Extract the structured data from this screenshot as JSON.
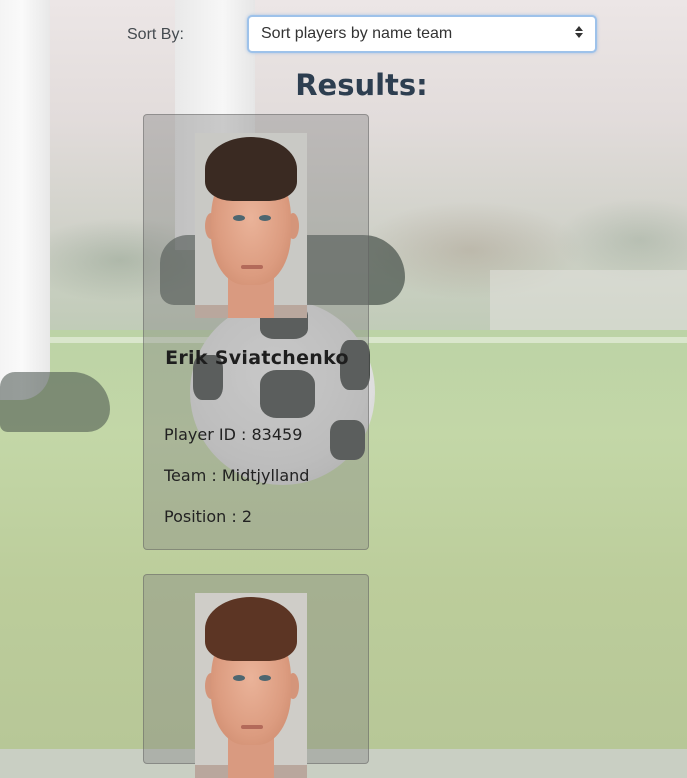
{
  "sort": {
    "label": "Sort By:",
    "selected": "Sort players by name team"
  },
  "results_heading": "Results:",
  "players": [
    {
      "name": "Erik Sviatchenko",
      "id_label": "Player ID : ",
      "id": "83459",
      "team_label": "Team : ",
      "team": "Midtjylland",
      "position_label": "Position : ",
      "position": "2"
    },
    {
      "name": ""
    }
  ],
  "colors": {
    "heading": "#2d3e50",
    "select_focus_border": "#9ec2ea",
    "card_background": "rgba(130,130,130,0.38)"
  },
  "icons": {
    "select_arrows": "sort-arrows-icon"
  }
}
